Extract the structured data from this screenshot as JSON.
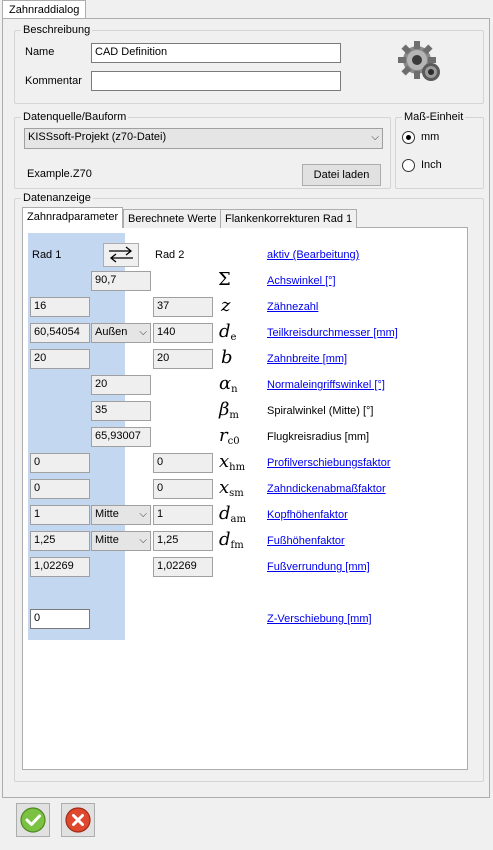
{
  "window": {
    "tab": "Zahnraddialog"
  },
  "beschreibung": {
    "legend": "Beschreibung",
    "name_label": "Name",
    "name_value": "CAD Definition",
    "kommentar_label": "Kommentar",
    "kommentar_value": ""
  },
  "datenquelle": {
    "legend": "Datenquelle/Bauform",
    "selected": "KISSsoft-Projekt (z70-Datei)",
    "file": "Example.Z70",
    "load_button": "Datei laden"
  },
  "masseinheit": {
    "legend": "Maß-Einheit",
    "options": [
      "mm",
      "Inch"
    ],
    "selected": "mm"
  },
  "datenanzeige": {
    "legend": "Datenanzeige",
    "tabs": [
      "Zahnradparameter",
      "Berechnete Werte",
      "Flankenkorrekturen Rad 1"
    ],
    "active_tab": "Zahnradparameter"
  },
  "params": {
    "rad1_label": "Rad 1",
    "rad2_label": "Rad 2",
    "aktiv_link": "aktiv (Bearbeitung)",
    "rows": [
      {
        "name": "achswinkel",
        "mid": "90,7",
        "sym": "Σ",
        "sub": "",
        "label": "Achswinkel [°]",
        "link": true
      },
      {
        "name": "zaehnezahl",
        "r1": "16",
        "r2": "37",
        "sym": "z",
        "sub": "",
        "label": "Zähnezahl",
        "link": true
      },
      {
        "name": "teilkreisdurchmesser",
        "r1": "60,54054",
        "dd": "Außen",
        "r2": "140",
        "sym": "d",
        "sub": "e",
        "label": "Teilkreisdurchmesser [mm]",
        "link": true
      },
      {
        "name": "zahnbreite",
        "r1": "20",
        "r2": "20",
        "sym": "b",
        "sub": "",
        "label": "Zahnbreite [mm]",
        "link": true
      },
      {
        "name": "normaleingriffswinkel",
        "mid": "20",
        "sym": "α",
        "sub": "n",
        "label": "Normaleingriffswinkel [°]",
        "link": true
      },
      {
        "name": "spiralwinkel",
        "mid": "35",
        "sym": "β",
        "sub": "m",
        "label": "Spiralwinkel (Mitte) [°]",
        "link": false
      },
      {
        "name": "flugkreisradius",
        "mid": "65,93007",
        "sym": "r",
        "sub": "c0",
        "label": "Flugkreisradius [mm]",
        "link": false
      },
      {
        "name": "profilverschiebungsfaktor",
        "r1": "0",
        "r2": "0",
        "sym": "x",
        "sub": "hm",
        "label": "Profilverschiebungsfaktor",
        "link": true
      },
      {
        "name": "zahndickenabmassfaktor",
        "r1": "0",
        "r2": "0",
        "sym": "x",
        "sub": "sm",
        "label": "Zahndickenabmaßfaktor",
        "link": true
      },
      {
        "name": "kopfhoehenfaktor",
        "r1": "1",
        "dd": "Mitte",
        "r2": "1",
        "sym": "d",
        "sub": "am",
        "label": "Kopfhöhenfaktor",
        "link": true
      },
      {
        "name": "fusshoehenfaktor",
        "r1": "1,25",
        "dd": "Mitte",
        "r2": "1,25",
        "sym": "d",
        "sub": "fm",
        "label": "Fußhöhenfaktor",
        "link": true
      },
      {
        "name": "fussverrundung",
        "r1": "1,02269",
        "r2": "1,02269",
        "sym": "",
        "sub": "",
        "label": "Fußverrundung [mm]",
        "link": true
      }
    ],
    "zshift_value": "0",
    "zshift_label": "Z-Verschiebung [mm]"
  },
  "footer": {
    "ok_icon": "check-icon",
    "cancel_icon": "close-icon"
  }
}
